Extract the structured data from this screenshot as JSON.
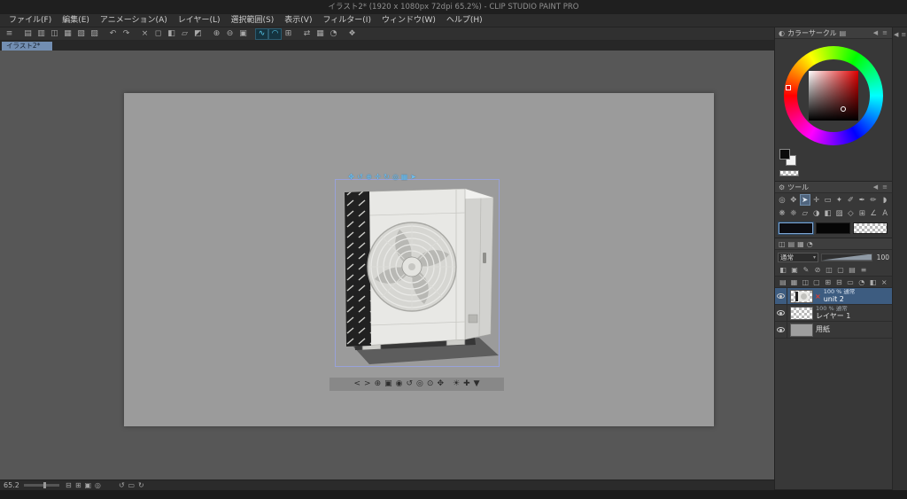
{
  "window": {
    "title": "イラスト2* (1920 x 1080px 72dpi 65.2%) - CLIP STUDIO PAINT PRO"
  },
  "menu": {
    "items": [
      "ファイル(F)",
      "編集(E)",
      "アニメーション(A)",
      "レイヤー(L)",
      "選択範囲(S)",
      "表示(V)",
      "フィルター(I)",
      "ウィンドウ(W)",
      "ヘルプ(H)"
    ]
  },
  "toolbar": {
    "icons": [
      {
        "name": "app-menu-icon",
        "glyph": "≡"
      },
      {
        "name": "new-file-icon",
        "glyph": "▤",
        "gap": true
      },
      {
        "name": "open-file-icon",
        "glyph": "▥"
      },
      {
        "name": "save-icon",
        "glyph": "◫"
      },
      {
        "name": "save-all-icon",
        "glyph": "▦"
      },
      {
        "name": "export-icon",
        "glyph": "▧"
      },
      {
        "name": "print-icon",
        "glyph": "▨"
      },
      {
        "name": "undo-icon",
        "glyph": "↶",
        "gap": true
      },
      {
        "name": "redo-icon",
        "glyph": "↷"
      },
      {
        "name": "delete-icon",
        "glyph": "×",
        "gap": true
      },
      {
        "name": "clear-outside-icon",
        "glyph": "◻"
      },
      {
        "name": "fill-icon",
        "glyph": "◧"
      },
      {
        "name": "deselect-icon",
        "glyph": "▱"
      },
      {
        "name": "invert-selection-icon",
        "glyph": "◩"
      },
      {
        "name": "zoom-in-icon",
        "glyph": "⊕",
        "gap": true
      },
      {
        "name": "zoom-out-icon",
        "glyph": "⊖"
      },
      {
        "name": "fit-to-screen-icon",
        "glyph": "▣"
      },
      {
        "name": "snap-ruler-icon",
        "glyph": "∿",
        "gap": true,
        "active": true
      },
      {
        "name": "snap-special-ruler-icon",
        "glyph": "◠",
        "active": true
      },
      {
        "name": "snap-grid-icon",
        "glyph": "⊞"
      },
      {
        "name": "flip-view-icon",
        "glyph": "⇄",
        "gap": true
      },
      {
        "name": "grid-view-icon",
        "glyph": "▦"
      },
      {
        "name": "rotate-view-icon",
        "glyph": "◔"
      },
      {
        "name": "material-palette-icon",
        "glyph": "❖",
        "gap": true
      }
    ]
  },
  "document_tab": {
    "label": "イラスト2*"
  },
  "object_launcher": {
    "top_tools": [
      {
        "name": "camera-orbit-icon",
        "glyph": "✥"
      },
      {
        "name": "camera-pan-icon",
        "glyph": "↺"
      },
      {
        "name": "camera-zoom-icon",
        "glyph": "⊕"
      },
      {
        "name": "object-move-icon",
        "glyph": "✛"
      },
      {
        "name": "object-rotate-icon",
        "glyph": "↻"
      },
      {
        "name": "object-plane-move-icon",
        "glyph": "◎"
      },
      {
        "name": "object-snap-icon",
        "glyph": "▦"
      },
      {
        "name": "object-menu-icon",
        "glyph": "➤"
      }
    ],
    "bottom_tools": [
      {
        "name": "prev-camera-angle-icon",
        "glyph": "<"
      },
      {
        "name": "next-camera-angle-icon",
        "glyph": ">"
      },
      {
        "name": "launcher-camera-zoom-icon",
        "glyph": "⊕"
      },
      {
        "name": "launcher-camera-pan-icon",
        "glyph": "▣"
      },
      {
        "name": "launcher-camera-orbit-icon",
        "glyph": "◉"
      },
      {
        "name": "launcher-rotate-left-icon",
        "glyph": "↺"
      },
      {
        "name": "launcher-object-rotate-icon",
        "glyph": "◎"
      },
      {
        "name": "launcher-object-roll-icon",
        "glyph": "⊙"
      },
      {
        "name": "launcher-object-move-icon",
        "glyph": "✥"
      },
      {
        "name": "light-source-icon",
        "glyph": "☀",
        "gap": true
      },
      {
        "name": "ground-snap-icon",
        "glyph": "✚"
      },
      {
        "name": "drop-to-floor-icon",
        "glyph": "▼"
      }
    ]
  },
  "color_panel": {
    "title": "カラーサークル",
    "tab_icons": [
      {
        "name": "color-wheel-tab-icon",
        "glyph": "◐"
      },
      {
        "name": "color-slider-tab-icon",
        "glyph": "▤"
      }
    ]
  },
  "panel_chrome": {
    "collapse_glyph": "◀",
    "menu_glyph": "≡"
  },
  "tool_panel": {
    "title": "ツール",
    "row1": [
      {
        "name": "zoom-tool-icon",
        "glyph": "◎"
      },
      {
        "name": "move-tool-icon",
        "glyph": "✥"
      },
      {
        "name": "operate-tool-icon",
        "glyph": "➤",
        "active": true
      },
      {
        "name": "layer-move-tool-icon",
        "glyph": "✛"
      },
      {
        "name": "selection-tool-icon",
        "glyph": "▭"
      },
      {
        "name": "auto-select-tool-icon",
        "glyph": "✦"
      },
      {
        "name": "eyedropper-tool-icon",
        "glyph": "✐"
      },
      {
        "name": "pen-tool-icon",
        "glyph": "✒"
      },
      {
        "name": "pencil-tool-icon",
        "glyph": "✏"
      },
      {
        "name": "brush-tool-icon",
        "glyph": "◗"
      }
    ],
    "row2": [
      {
        "name": "airbrush-tool-icon",
        "glyph": "❋"
      },
      {
        "name": "decoration-tool-icon",
        "glyph": "❈"
      },
      {
        "name": "eraser-tool-icon",
        "glyph": "▱"
      },
      {
        "name": "blend-tool-icon",
        "glyph": "◑"
      },
      {
        "name": "fill-tool-icon",
        "glyph": "◧"
      },
      {
        "name": "gradient-tool-icon",
        "glyph": "▨"
      },
      {
        "name": "figure-tool-icon",
        "glyph": "◇"
      },
      {
        "name": "frame-border-tool-icon",
        "glyph": "⊞"
      },
      {
        "name": "ruler-tool-icon",
        "glyph": "∠"
      },
      {
        "name": "text-tool-icon",
        "glyph": "A"
      }
    ]
  },
  "layer_panel": {
    "tab_icons": [
      {
        "name": "layer-palette-tab-icon",
        "glyph": "◫"
      },
      {
        "name": "layer-property-tab-icon",
        "glyph": "▤"
      },
      {
        "name": "layer-search-tab-icon",
        "glyph": "▦"
      },
      {
        "name": "animation-cel-tab-icon",
        "glyph": "◔"
      }
    ],
    "blend_mode": "通常",
    "opacity_value": "100",
    "prop_icons": [
      {
        "name": "lock-transparent-pixels-icon",
        "glyph": "◧"
      },
      {
        "name": "lock-layer-icon",
        "glyph": "▣"
      },
      {
        "name": "draft-layer-icon",
        "glyph": "✎"
      },
      {
        "name": "exclude-from-refer-icon",
        "glyph": "⊘"
      },
      {
        "name": "clip-to-layer-below-icon",
        "glyph": "◫"
      },
      {
        "name": "reference-layer-icon",
        "glyph": "▢"
      },
      {
        "name": "layer-color-icon",
        "glyph": "▤"
      },
      {
        "name": "palette-options-icon",
        "glyph": "≡"
      }
    ],
    "action_icons": [
      {
        "name": "new-raster-layer-icon",
        "glyph": "▤"
      },
      {
        "name": "new-vector-layer-icon",
        "glyph": "▦"
      },
      {
        "name": "new-folder-icon",
        "glyph": "◫"
      },
      {
        "name": "transfer-to-lower-icon",
        "glyph": "▢"
      },
      {
        "name": "combine-to-lower-icon",
        "glyph": "⊞"
      },
      {
        "name": "merge-down-icon",
        "glyph": "⊟"
      },
      {
        "name": "create-mask-icon",
        "glyph": "▭"
      },
      {
        "name": "apply-mask-icon",
        "glyph": "◔"
      },
      {
        "name": "mask-enable-icon",
        "glyph": "◧"
      },
      {
        "name": "delete-layer-icon",
        "glyph": "×"
      }
    ],
    "layers": [
      {
        "info": "100 % 通常",
        "name": "unit 2",
        "selected": true
      },
      {
        "info": "100 % 通常",
        "name": "レイヤー 1",
        "selected": false
      },
      {
        "info": "",
        "name": "用紙",
        "selected": false
      }
    ],
    "badge_glyph": "×"
  },
  "edge_dock": {
    "icons": [
      {
        "name": "dock-collapse-icon",
        "glyph": "◀"
      },
      {
        "name": "dock-menu-icon",
        "glyph": "≡"
      }
    ]
  },
  "statusbar": {
    "zoom_value": "65.2",
    "zoom_icons": [
      {
        "name": "zoom-out-icon",
        "glyph": "⊟"
      },
      {
        "name": "zoom-in-icon",
        "glyph": "⊞"
      },
      {
        "name": "fit-to-window-icon",
        "glyph": "▣"
      },
      {
        "name": "actual-size-icon",
        "glyph": "◎"
      }
    ],
    "rotate_icons": [
      {
        "name": "rotate-left-icon",
        "glyph": "↺"
      },
      {
        "name": "reset-rotation-icon",
        "glyph": "▭"
      },
      {
        "name": "rotate-right-icon",
        "glyph": "↻"
      }
    ]
  },
  "colors": {
    "accent_blue": "#58cdf2",
    "layer_selection": "#3d5c80",
    "current_hue": "#e00000",
    "paper_gray": "#9b9b9b"
  }
}
